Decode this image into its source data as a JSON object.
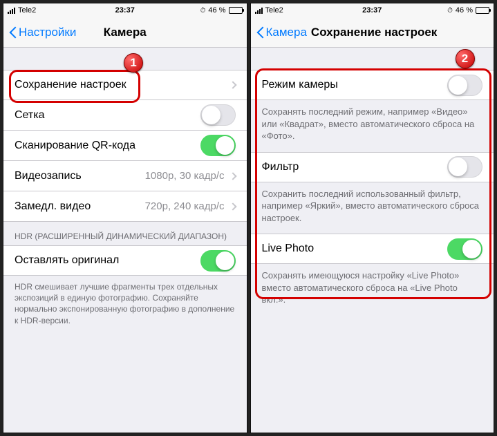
{
  "status": {
    "carrier": "Tele2",
    "time": "23:37",
    "battery_pct": "46 %"
  },
  "callouts": {
    "one": "1",
    "two": "2"
  },
  "screen1": {
    "back_label": "Настройки",
    "title": "Камера",
    "rows": {
      "preserve": "Сохранение настроек",
      "grid": "Сетка",
      "qr": "Сканирование QR-кода",
      "video": "Видеозапись",
      "video_detail": "1080p, 30 кадр/с",
      "slomo": "Замедл. видео",
      "slomo_detail": "720p, 240 кадр/с"
    },
    "hdr_header": "HDR (РАСШИРЕННЫЙ ДИНАМИЧЕСКИЙ ДИАПАЗОН)",
    "keep_original": "Оставлять оригинал",
    "hdr_footer": "HDR смешивает лучшие фрагменты трех отдельных экспозиций в единую фотографию. Сохраняйте нормально экспонированную фотографию в дополнение к HDR-версии."
  },
  "screen2": {
    "back_label": "Камера",
    "title": "Сохранение настроек",
    "camera_mode": {
      "label": "Режим камеры",
      "desc": "Сохранять последний режим, например «Видео» или «Квадрат», вместо автоматического сброса на «Фото»."
    },
    "filter": {
      "label": "Фильтр",
      "desc": "Сохранить последний использованный фильтр, например «Яркий», вместо автоматического сброса настроек."
    },
    "live_photo": {
      "label": "Live Photo",
      "desc": "Сохранять имеющуюся настройку «Live Photo» вместо автоматического сброса на «Live Photo вкл.»."
    }
  }
}
